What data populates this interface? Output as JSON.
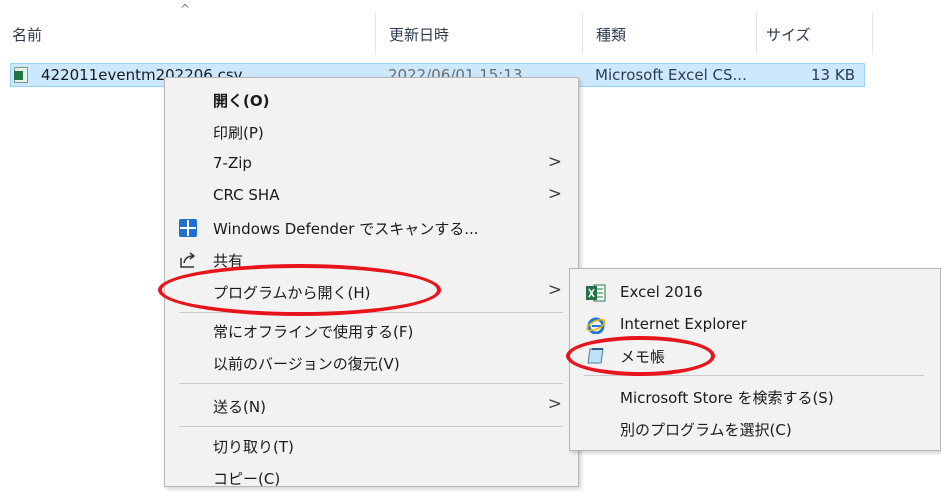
{
  "explorer": {
    "columns": {
      "name": "名前",
      "modified": "更新日時",
      "type": "種類",
      "size": "サイズ"
    },
    "sort_indicator": "^",
    "file": {
      "name": "422011eventm202206.csv",
      "modified": "2022/06/01 15:13",
      "type": "Microsoft Excel CS...",
      "size": "13 KB"
    }
  },
  "context_menu": {
    "items": [
      {
        "label": "開く(O)",
        "bold": true
      },
      {
        "label": "印刷(P)"
      },
      {
        "label": "7-Zip",
        "submenu": true
      },
      {
        "label": "CRC SHA",
        "submenu": true
      },
      {
        "label": "Windows Defender でスキャンする...",
        "icon": "defender-shield-icon"
      },
      {
        "label": "共有",
        "icon": "share-icon"
      },
      {
        "label": "プログラムから開く(H)",
        "submenu": true,
        "highlighted": true
      },
      {
        "label": "常にオフラインで使用する(F)"
      },
      {
        "label": "以前のバージョンの復元(V)"
      },
      {
        "label": "送る(N)",
        "submenu": true
      },
      {
        "label": "切り取り(T)"
      },
      {
        "label": "コピー(C)"
      }
    ],
    "submenu_arrow": ">"
  },
  "open_with_submenu": {
    "items": [
      {
        "label": "Excel 2016",
        "icon": "excel-icon"
      },
      {
        "label": "Internet Explorer",
        "icon": "internet-explorer-icon"
      },
      {
        "label": "メモ帳",
        "icon": "notepad-icon",
        "highlighted": true
      },
      {
        "label": "Microsoft Store を検索する(S)"
      },
      {
        "label": "別のプログラムを選択(C)"
      }
    ]
  },
  "colors": {
    "selection": "#cce8ff",
    "menu_bg": "#f2f2f2",
    "annotation": "#e8141b"
  }
}
